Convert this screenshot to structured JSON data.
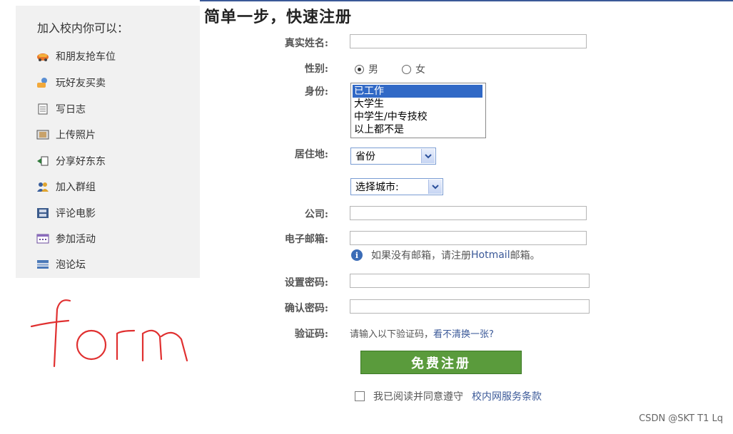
{
  "sidebar": {
    "title": "加入校内你可以：",
    "items": [
      {
        "label": "和朋友抢车位",
        "icon": "car-icon"
      },
      {
        "label": "玩好友买卖",
        "icon": "friends-trade-icon"
      },
      {
        "label": "写日志",
        "icon": "notebook-icon"
      },
      {
        "label": "上传照片",
        "icon": "photo-icon"
      },
      {
        "label": "分享好东东",
        "icon": "share-icon"
      },
      {
        "label": "加入群组",
        "icon": "group-icon"
      },
      {
        "label": "评论电影",
        "icon": "film-icon"
      },
      {
        "label": "参加活动",
        "icon": "calendar-icon"
      },
      {
        "label": "泡论坛",
        "icon": "forum-icon"
      }
    ]
  },
  "form": {
    "title": "简单一步，快速注册",
    "real_name_label": "真实姓名:",
    "real_name_value": "",
    "gender_label": "性别:",
    "gender_male": "男",
    "gender_female": "女",
    "identity_label": "身份:",
    "identity_options": [
      "已工作",
      "大学生",
      "中学生/中专技校",
      "以上都不是"
    ],
    "residence_label": "居住地:",
    "province_value": "省份",
    "city_value": "选择城市:",
    "company_label": "公司:",
    "company_value": "",
    "email_label": "电子邮箱:",
    "email_value": "",
    "email_hint_prefix": "如果没有邮箱，请注册",
    "email_hint_link": "Hotmail",
    "email_hint_suffix": "邮箱。",
    "password_label": "设置密码:",
    "password_value": "",
    "confirm_label": "确认密码:",
    "confirm_value": "",
    "captcha_label": "验证码:",
    "captcha_prompt": "请输入以下验证码，",
    "captcha_link": "看不清换一张?",
    "submit_label": "免费注册",
    "agree_text": "我已阅读并同意遵守",
    "agree_link": "校内网服务条款"
  },
  "annotation": {
    "text": "form"
  },
  "watermark": "CSDN @SKT T1 Lq",
  "colors": {
    "accent": "#3b5998",
    "submit": "#5a9b3c",
    "selection": "#3169c6",
    "handwriting": "#e03030"
  }
}
